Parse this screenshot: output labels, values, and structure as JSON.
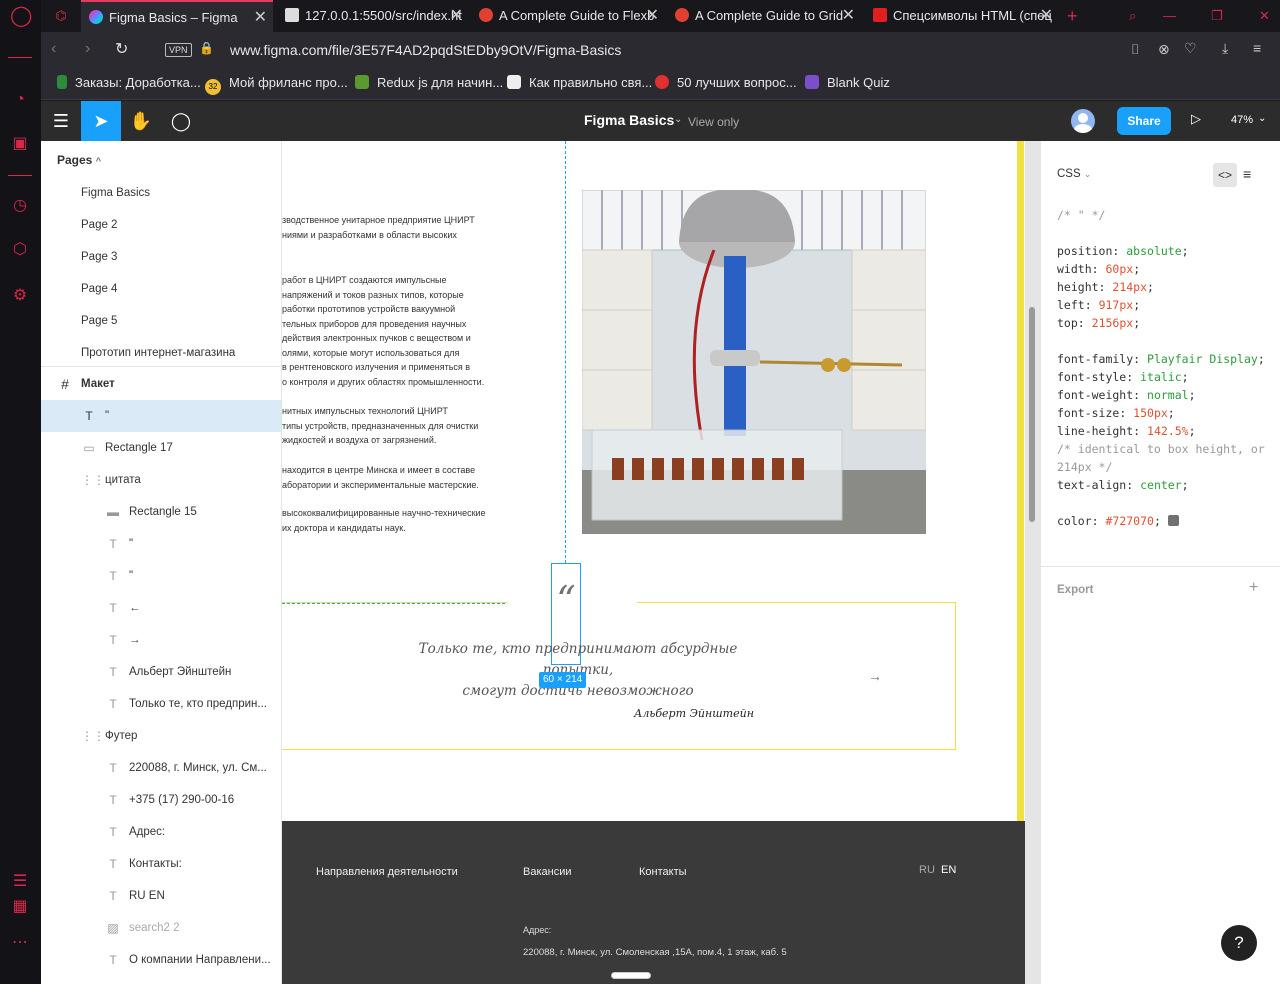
{
  "tabs": [
    {
      "label": "Figma Basics – Figma",
      "active": true
    },
    {
      "label": "127.0.0.1:5500/src/index.ht"
    },
    {
      "label": "A Complete Guide to Flexb"
    },
    {
      "label": "A Complete Guide to Grid"
    },
    {
      "label": "Спецсимволы HTML (спец"
    }
  ],
  "address": {
    "vpn": "VPN",
    "url": "www.figma.com/file/3E57F4AD2pqdStEDby9OtV/Figma-Basics"
  },
  "bookmarks": [
    {
      "label": "Заказы: Доработка..."
    },
    {
      "label": "Мой фриланс про...",
      "badge": "32"
    },
    {
      "label": "Redux js для начин..."
    },
    {
      "label": "Как правильно свя..."
    },
    {
      "label": "50 лучших вопрос..."
    },
    {
      "label": "Blank Quiz"
    }
  ],
  "toolbar": {
    "file_title": "Figma Basics",
    "view_only": "View only",
    "share": "Share",
    "zoom": "47%"
  },
  "pages": {
    "header": "Pages",
    "items": [
      "Figma Basics",
      "Page 2",
      "Page 3",
      "Page 4",
      "Page 5",
      "Прототип интернет-магазина"
    ]
  },
  "layers": [
    {
      "icon": "#",
      "label": "Макет",
      "level": 0,
      "selected": false,
      "bold": true
    },
    {
      "icon": "T",
      "label": "\"",
      "level": 1,
      "selected": true
    },
    {
      "icon": "▭",
      "label": "Rectangle 17",
      "level": 1
    },
    {
      "icon": "⋮⋮",
      "label": "цитата",
      "level": 1
    },
    {
      "icon": "▬",
      "label": "Rectangle 15",
      "level": 2
    },
    {
      "icon": "T",
      "label": "\"",
      "level": 2
    },
    {
      "icon": "T",
      "label": "\"",
      "level": 2
    },
    {
      "icon": "T",
      "label": "←",
      "level": 2
    },
    {
      "icon": "T",
      "label": "→",
      "level": 2
    },
    {
      "icon": "T",
      "label": "Альберт Эйнштейн",
      "level": 2
    },
    {
      "icon": "T",
      "label": "Только те, кто предприн...",
      "level": 2
    },
    {
      "icon": "⋮⋮",
      "label": "Футер",
      "level": 1
    },
    {
      "icon": "T",
      "label": "220088, г. Минск, ул. См...",
      "level": 2
    },
    {
      "icon": "T",
      "label": "+375 (17) 290-00-16",
      "level": 2
    },
    {
      "icon": "T",
      "label": "Адрес:",
      "level": 2
    },
    {
      "icon": "T",
      "label": "Контакты:",
      "level": 2
    },
    {
      "icon": "T",
      "label": "RU EN",
      "level": 2
    },
    {
      "icon": "▨",
      "label": "search2 2",
      "level": 2,
      "muted": true
    },
    {
      "icon": "T",
      "label": "О компании Направлени...",
      "level": 2
    }
  ],
  "canvas": {
    "paragraphs": [
      [
        "зводственное унитарное предприятие ЦНИРТ",
        "ниями и разработками в области высоких"
      ],
      [
        "работ в ЦНИРТ создаются импульсные",
        "напряжений и токов разных типов, которые",
        "работки прототипов устройств вакуумной",
        "тельных приборов для проведения научных",
        "действия электронных пучков с веществом и",
        "олями, которые могут использоваться для",
        "в рентгеновского излучения и применяться в",
        "о контроля и других областях промышленности."
      ],
      [
        "нитных импульсных технологий ЦНИРТ",
        "типы устройств, предназначенных для очистки",
        "жидкостей и воздуха от загрязнений."
      ],
      [
        "находится в центре Минска и имеет в составе",
        "аборатории и экспериментальные мастерские."
      ],
      [
        "высококвалифицированные научно-технические",
        "их доктора и кандидаты наук."
      ]
    ],
    "quote_mark": "“",
    "quote_lines": [
      "Только те, кто предпринимают абсурдные попытки,",
      "смогут достичь невозможного"
    ],
    "quote_author": "Альберт Эйнштейн",
    "arrow_right": "→",
    "size_badge": "60 × 214",
    "footer": {
      "nav": [
        "Направления деятельности",
        "Вакансии",
        "Контакты"
      ],
      "lang_ru": "RU",
      "lang_en": "EN",
      "address_label": "Адрес:",
      "address": "220088, г. Минск, ул. Смоленская ,15А, пом.4, 1 этаж, каб. 5"
    }
  },
  "inspect": {
    "tab": "CSS",
    "comment": "/* \" */",
    "props": [
      {
        "k": "position",
        "v": "absolute",
        "type": "g"
      },
      {
        "k": "width",
        "v": "60px",
        "type": "v"
      },
      {
        "k": "height",
        "v": "214px",
        "type": "v"
      },
      {
        "k": "left",
        "v": "917px",
        "type": "v"
      },
      {
        "k": "top",
        "v": "2156px",
        "type": "v"
      }
    ],
    "props2": [
      {
        "k": "font-family",
        "v": "Playfair Display",
        "type": "g"
      },
      {
        "k": "font-style",
        "v": "italic",
        "type": "g"
      },
      {
        "k": "font-weight",
        "v": "normal",
        "type": "g"
      },
      {
        "k": "font-size",
        "v": "150px",
        "type": "v"
      },
      {
        "k": "line-height",
        "v": "142.5%",
        "type": "v"
      }
    ],
    "comment2a": "/* identical to box height, or",
    "comment2b": "214px */",
    "text_align": {
      "k": "text-align",
      "v": "center"
    },
    "color": {
      "k": "color",
      "v": "#727070"
    },
    "export": "Export"
  },
  "help": "?"
}
